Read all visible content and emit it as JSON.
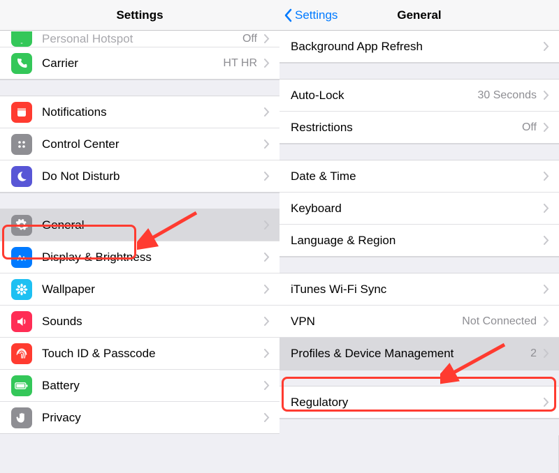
{
  "left": {
    "title": "Settings",
    "partial": {
      "label": "Personal Hotspot",
      "value": "Off"
    },
    "group1": [
      {
        "key": "carrier",
        "label": "Carrier",
        "value": "HT HR",
        "icon": "phone-icon",
        "bg": "bg-green"
      }
    ],
    "group2": [
      {
        "key": "notifications",
        "label": "Notifications",
        "icon": "notifications-icon",
        "bg": "bg-red"
      },
      {
        "key": "controlcenter",
        "label": "Control Center",
        "icon": "control-center-icon",
        "bg": "bg-gray"
      },
      {
        "key": "dnd",
        "label": "Do Not Disturb",
        "icon": "moon-icon",
        "bg": "bg-purple"
      }
    ],
    "group3": [
      {
        "key": "general",
        "label": "General",
        "icon": "gear-icon",
        "bg": "bg-gear",
        "selected": true
      },
      {
        "key": "display",
        "label": "Display & Brightness",
        "icon": "display-icon",
        "bg": "bg-blueA"
      },
      {
        "key": "wallpaper",
        "label": "Wallpaper",
        "icon": "flower-icon",
        "bg": "bg-cyan"
      },
      {
        "key": "sounds",
        "label": "Sounds",
        "icon": "sounds-icon",
        "bg": "bg-pink"
      },
      {
        "key": "touchid",
        "label": "Touch ID & Passcode",
        "icon": "fingerprint-icon",
        "bg": "bg-redf"
      },
      {
        "key": "battery",
        "label": "Battery",
        "icon": "battery-icon",
        "bg": "bg-greens"
      },
      {
        "key": "privacy",
        "label": "Privacy",
        "icon": "hand-icon",
        "bg": "bg-grayh"
      }
    ]
  },
  "right": {
    "back": "Settings",
    "title": "General",
    "g1": [
      {
        "key": "bg-app",
        "label": "Background App Refresh"
      }
    ],
    "g2": [
      {
        "key": "autolock",
        "label": "Auto-Lock",
        "value": "30 Seconds"
      },
      {
        "key": "restrictions",
        "label": "Restrictions",
        "value": "Off"
      }
    ],
    "g3": [
      {
        "key": "datetime",
        "label": "Date & Time"
      },
      {
        "key": "keyboard",
        "label": "Keyboard"
      },
      {
        "key": "lang",
        "label": "Language & Region"
      }
    ],
    "g4": [
      {
        "key": "itunes",
        "label": "iTunes Wi-Fi Sync"
      },
      {
        "key": "vpn",
        "label": "VPN",
        "value": "Not Connected"
      },
      {
        "key": "profiles",
        "label": "Profiles & Device Management",
        "value": "2",
        "selected": true
      }
    ],
    "g5": [
      {
        "key": "regulatory",
        "label": "Regulatory"
      }
    ]
  }
}
